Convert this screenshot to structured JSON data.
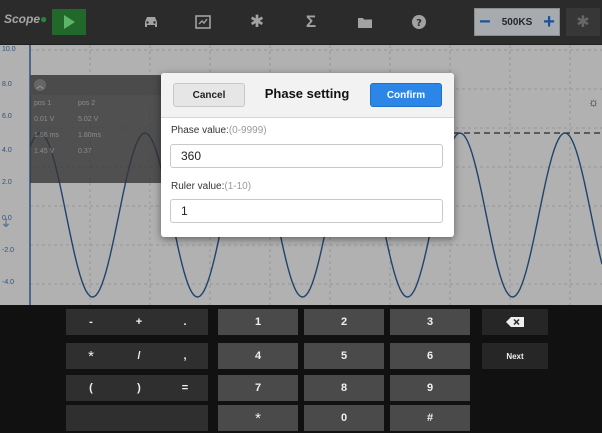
{
  "toolbar": {
    "logo": "Scope",
    "sample_rate": "500KS",
    "icons": [
      "play-icon",
      "car-icon",
      "report-icon",
      "gear-icon",
      "sigma-icon",
      "folder-icon",
      "help-icon",
      "settings-icon"
    ]
  },
  "plot": {
    "y_ticks": [
      "10.0",
      "8.0",
      "6.0",
      "4.0",
      "2.0",
      "0.0",
      "-2.0",
      "-4.0"
    ],
    "table_headers": [
      "pos 1",
      "pos 2"
    ],
    "table_rows": [
      [
        "0.01 V",
        "5.02 V"
      ],
      [
        "1.56 ms",
        "1.80ms"
      ],
      [
        "1.45 V",
        "0.37"
      ]
    ]
  },
  "dialog": {
    "cancel_label": "Cancel",
    "title": "Phase setting",
    "confirm_label": "Confirm",
    "phase_label": "Phase value:",
    "phase_hint": "(0-9999)",
    "phase_value": "360",
    "ruler_label": "Ruler value:",
    "ruler_hint": "(1-10)",
    "ruler_value": "1"
  },
  "keyboard": {
    "keys": [
      "-",
      "+",
      ".",
      "1",
      "2",
      "3",
      "*",
      "/",
      ",",
      "4",
      "5",
      "6",
      "Next",
      "(",
      ")",
      "=",
      "7",
      "8",
      "9",
      "*",
      "0",
      "#"
    ]
  },
  "colors": {
    "waveform": "#2d5a8f",
    "accent": "#2b86e8",
    "play": "#2e8b3a"
  }
}
